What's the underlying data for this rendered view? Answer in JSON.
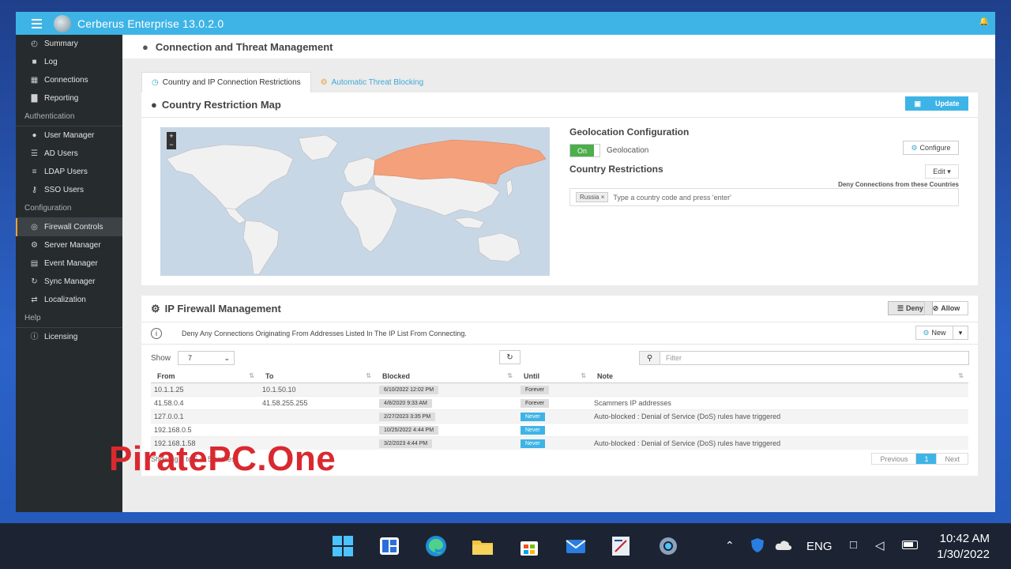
{
  "app": {
    "title": "Cerberus Enterprise 13.0.2.0"
  },
  "sidebar": {
    "items": [
      {
        "label": "Summary",
        "icon": "dashboard-icon"
      },
      {
        "label": "Log",
        "icon": "log-icon"
      },
      {
        "label": "Connections",
        "icon": "grid-icon"
      },
      {
        "label": "Reporting",
        "icon": "bar-chart-icon"
      }
    ],
    "auth_heading": "Authentication",
    "auth_items": [
      {
        "label": "User Manager",
        "icon": "user-icon"
      },
      {
        "label": "AD Users",
        "icon": "list-icon"
      },
      {
        "label": "LDAP Users",
        "icon": "database-icon"
      },
      {
        "label": "SSO Users",
        "icon": "key-icon"
      }
    ],
    "config_heading": "Configuration",
    "config_items": [
      {
        "label": "Firewall Controls",
        "icon": "globe-icon",
        "active": true
      },
      {
        "label": "Server Manager",
        "icon": "gear-icon"
      },
      {
        "label": "Event Manager",
        "icon": "calendar-icon"
      },
      {
        "label": "Sync Manager",
        "icon": "sync-icon"
      },
      {
        "label": "Localization",
        "icon": "transfer-icon"
      }
    ],
    "help_heading": "Help",
    "help_items": [
      {
        "label": "Licensing",
        "icon": "info-icon"
      }
    ]
  },
  "page": {
    "title": "Connection and Threat Management"
  },
  "tabs": [
    {
      "label": "Country and IP Connection Restrictions",
      "active": true
    },
    {
      "label": "Automatic Threat Blocking",
      "active": false
    }
  ],
  "geo": {
    "title": "Country Restriction Map",
    "update_label": "Update",
    "config_title": "Geolocation Configuration",
    "toggle_label": "On",
    "geolocation_label": "Geolocation",
    "configure_label": "Configure",
    "restrictions_title": "Country Restrictions",
    "edit_label": "Edit",
    "deny_label": "Deny Connections from these Countries",
    "country_tag": "Russia",
    "country_placeholder": "Type a country code and press 'enter'"
  },
  "firewall": {
    "title": "IP Firewall Management",
    "deny_label": "Deny",
    "allow_label": "Allow",
    "info_text": "Deny Any Connections Originating From Addresses Listed In The IP List From Connecting.",
    "new_label": "New",
    "show_label": "Show",
    "show_value": "7",
    "filter_placeholder": "Filter",
    "columns": [
      "From",
      "To",
      "Blocked",
      "Until",
      "Note"
    ],
    "rows": [
      {
        "from": "10.1.1.25",
        "to": "10.1.50.10",
        "blocked": "6/10/2022 12:02 PM",
        "until": "Forever",
        "note": ""
      },
      {
        "from": "41.58.0.4",
        "to": "41.58.255.255",
        "blocked": "4/8/2020 9:33 AM",
        "until": "Forever",
        "note": "Scammers IP addresses"
      },
      {
        "from": "127.0.0.1",
        "to": "",
        "blocked": "2/27/2023 3:35 PM",
        "until": "Never",
        "note": "Auto-blocked : Denial of Service (DoS) rules have triggered"
      },
      {
        "from": "192.168.0.5",
        "to": "",
        "blocked": "10/25/2022 4:44 PM",
        "until": "Never",
        "note": ""
      },
      {
        "from": "192.168.1.58",
        "to": "",
        "blocked": "3/2/2023 4:44 PM",
        "until": "Never",
        "note": "Auto-blocked : Denial of Service (DoS) rules have triggered"
      }
    ],
    "showing_text": "Showing 1 to 5 of 5 entries",
    "pager": {
      "prev": "Previous",
      "current": "1",
      "next": "Next"
    }
  },
  "watermark": "PiratePC.One",
  "taskbar": {
    "lang": "ENG",
    "time": "10:42 AM",
    "date": "1/30/2022"
  },
  "colors": {
    "accent": "#3eb4e6",
    "sidebar": "#262b2e",
    "restricted_country": "#f4a07a",
    "toggle_on": "#4cae4c"
  }
}
